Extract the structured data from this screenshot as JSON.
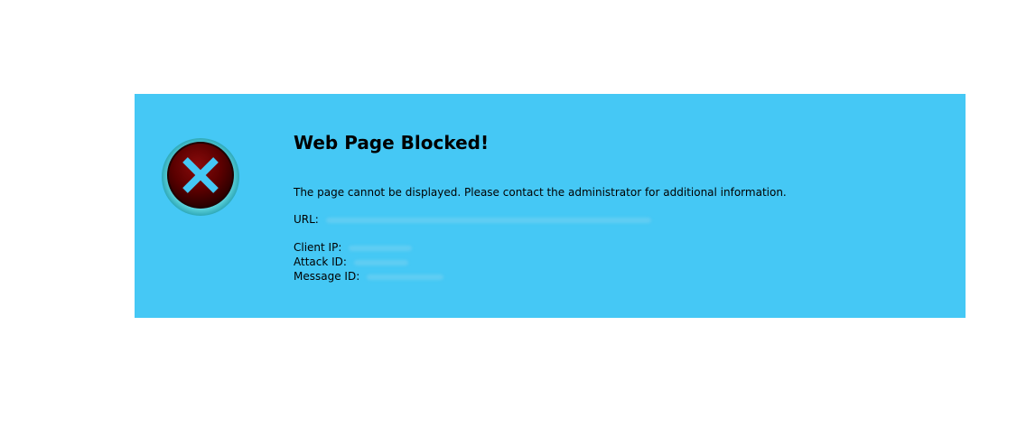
{
  "page": {
    "title": "Web Page Blocked!",
    "description": "The page cannot be displayed. Please contact the administrator for additional information.",
    "url_label": "URL:",
    "client_ip_label": "Client IP:",
    "attack_id_label": "Attack ID:",
    "message_id_label": "Message ID:"
  },
  "icons": {
    "blocked": "close-circle-icon"
  },
  "colors": {
    "panel_background": "#45c8f5",
    "icon_circle": "#5a0000",
    "icon_ring": "#3fb8c8",
    "icon_cross": "#45c8f5"
  }
}
